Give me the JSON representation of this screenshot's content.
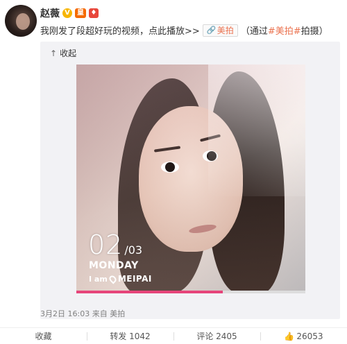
{
  "author": {
    "name": "赵薇"
  },
  "badges": {
    "v": "V",
    "vip": "皇",
    "red": "♦"
  },
  "post": {
    "text": "我刚发了段超好玩的视频，点此播放>>",
    "link_label": "美拍",
    "via_prefix": "（通过",
    "hashtag": "#美拍#",
    "via_suffix": "拍摄）"
  },
  "media": {
    "collapse_label": "收起",
    "collapse_icon": "↑",
    "overlay": {
      "index": "02",
      "total": "/03",
      "weekday": "MONDAY",
      "brand_prefix": "I am",
      "brand_name": "MEIPAI"
    },
    "progress": 0.64,
    "progress_color": "#e6457a"
  },
  "meta": {
    "timestamp": "3月2日 16:03",
    "source": "来自 美拍"
  },
  "actions": {
    "favorite": "收藏",
    "repost": "转发 1042",
    "comment": "评论 2405",
    "like": "26053",
    "like_icon": "👍"
  }
}
